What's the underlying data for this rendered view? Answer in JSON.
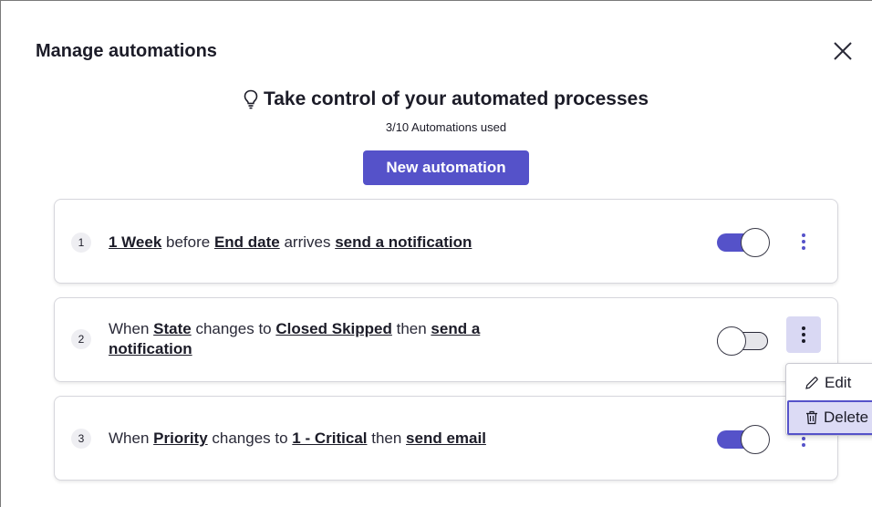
{
  "dialog": {
    "title": "Manage automations",
    "close_icon": "close-icon"
  },
  "hero": {
    "icon": "lightbulb-icon",
    "title": "Take control of your automated processes",
    "usage": "3/10 Automations used",
    "new_button": "New automation"
  },
  "automations": [
    {
      "index": "1",
      "parts": [
        "1 Week",
        " before ",
        "End date",
        " arrives ",
        "send a notification"
      ],
      "enabled": true
    },
    {
      "index": "2",
      "parts": [
        "When ",
        "State",
        " changes to ",
        "Closed Skipped",
        " then ",
        "send a",
        "notification"
      ],
      "enabled": false
    },
    {
      "index": "3",
      "parts": [
        "When ",
        "Priority",
        " changes to ",
        "1 - Critical",
        " then ",
        "send email"
      ],
      "enabled": true
    }
  ],
  "context_menu": {
    "edit_label": "Edit",
    "edit_icon": "pencil-icon",
    "delete_label": "Delete",
    "delete_icon": "trash-icon"
  },
  "colors": {
    "accent": "#5552c9",
    "accent_light": "#dcdbf5"
  }
}
